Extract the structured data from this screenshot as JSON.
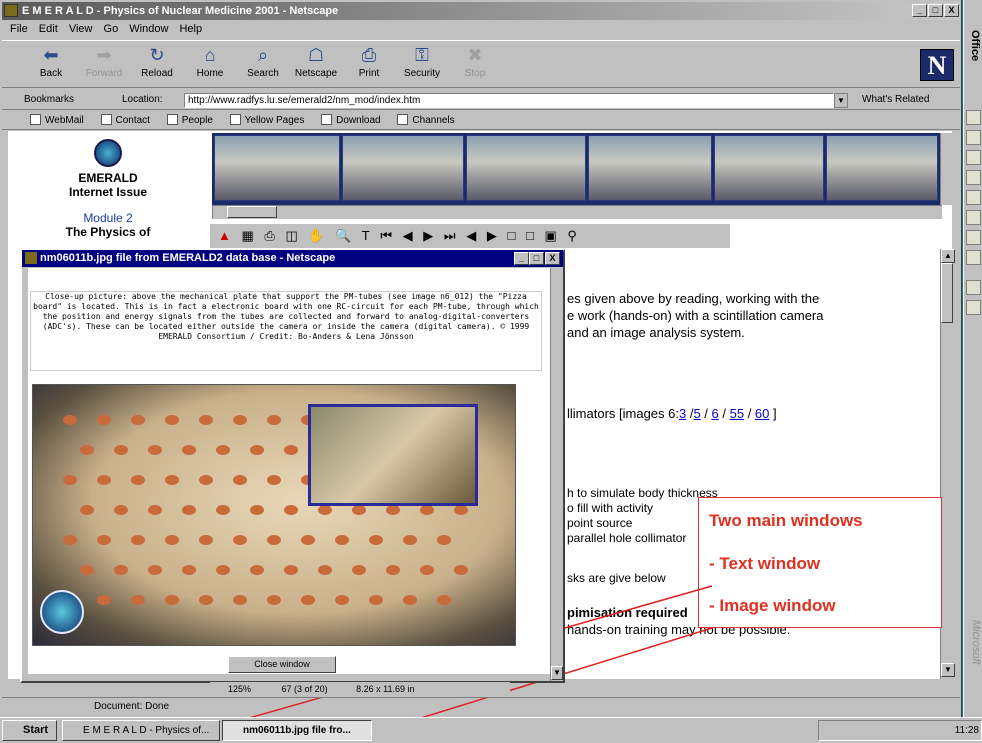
{
  "window": {
    "title": "E M E R A L D - Physics of Nuclear Medicine 2001 - Netscape",
    "min": "_",
    "max": "□",
    "close": "X"
  },
  "menu": [
    "File",
    "Edit",
    "View",
    "Go",
    "Window",
    "Help"
  ],
  "toolbar": [
    {
      "label": "Back",
      "icon": "back-arrow-icon",
      "glyph": "⬅",
      "enabled": true
    },
    {
      "label": "Forward",
      "icon": "forward-arrow-icon",
      "glyph": "➡",
      "enabled": false
    },
    {
      "label": "Reload",
      "icon": "reload-icon",
      "glyph": "↻",
      "enabled": true
    },
    {
      "label": "Home",
      "icon": "home-icon",
      "glyph": "⌂",
      "enabled": true
    },
    {
      "label": "Search",
      "icon": "search-icon",
      "glyph": "⌕",
      "enabled": true
    },
    {
      "label": "Netscape",
      "icon": "netscape-icon",
      "glyph": "☖",
      "enabled": true
    },
    {
      "label": "Print",
      "icon": "print-icon",
      "glyph": "⎙",
      "enabled": true
    },
    {
      "label": "Security",
      "icon": "security-lock-icon",
      "glyph": "⚿",
      "enabled": true
    },
    {
      "label": "Stop",
      "icon": "stop-icon",
      "glyph": "✖",
      "enabled": false
    }
  ],
  "location": {
    "bookmarks_label": "Bookmarks",
    "location_label": "Location:",
    "url": "http://www.radfys.lu.se/emerald2/nm_mod/index.htm",
    "related_label": "What's Related"
  },
  "personal_bar": [
    "WebMail",
    "Contact",
    "People",
    "Yellow Pages",
    "Download",
    "Channels"
  ],
  "left_nav": {
    "title_line1": "EMERALD",
    "title_line2": "Internet Issue",
    "module": "Module 2",
    "module_title": "The Physics of"
  },
  "main_text": {
    "line1": "es given above by reading, working with the",
    "line2": "e work (hands-on) with a scintillation camera",
    "line3": "and an image analysis system.",
    "collimators_prefix": "llimators [images 6:",
    "collimator_links": [
      "3",
      "5",
      "6",
      "55",
      "60"
    ],
    "collimators_suffix": "]",
    "list1": "h to simulate body thickness",
    "list2": "o fill with activity",
    "list3": "point source",
    "list4": "parallel hole collimator",
    "tasks": "sks are give below",
    "optim_heading": "pimisation required",
    "optim_text": "hands-on training may not be possible."
  },
  "popup": {
    "title": "nm06011b.jpg file from EMERALD2 data base - Netscape",
    "caption": "Close-up picture: above the mechanical plate that support the PM-tubes (see image n6_012) the \"Pizza board\" is located. This is in fact a electronic board with one RC-circuit for each PM-tube, through which the position and energy signals from the tubes are collected and forward to analog-digital-converters (ADC's). These can be located either outside the camera or inside the camera (digital camera). © 1999 EMERALD Consortium / Credit: Bo-Anders & Lena Jönsson",
    "close_button": "Close window"
  },
  "annotation": {
    "line1": "Two main windows",
    "line2": "- Text window",
    "line3": "- Image window"
  },
  "pdf_nav": {
    "zoom": "125%",
    "page": "67 (3 of 20)",
    "size": "8.26 x 11.69 in"
  },
  "status": {
    "text": "Document: Done"
  },
  "taskbar": {
    "start": "Start",
    "item1": "E M E R A L D - Physics of...",
    "item2": "nm06011b.jpg file fro...",
    "clock": "11:28"
  },
  "office_bar": {
    "title": "Office",
    "brand": "Microsoft"
  },
  "colors": {
    "annotation_red": "#e03020",
    "popup_title": "#000080",
    "link_blue": "#0000cc"
  }
}
